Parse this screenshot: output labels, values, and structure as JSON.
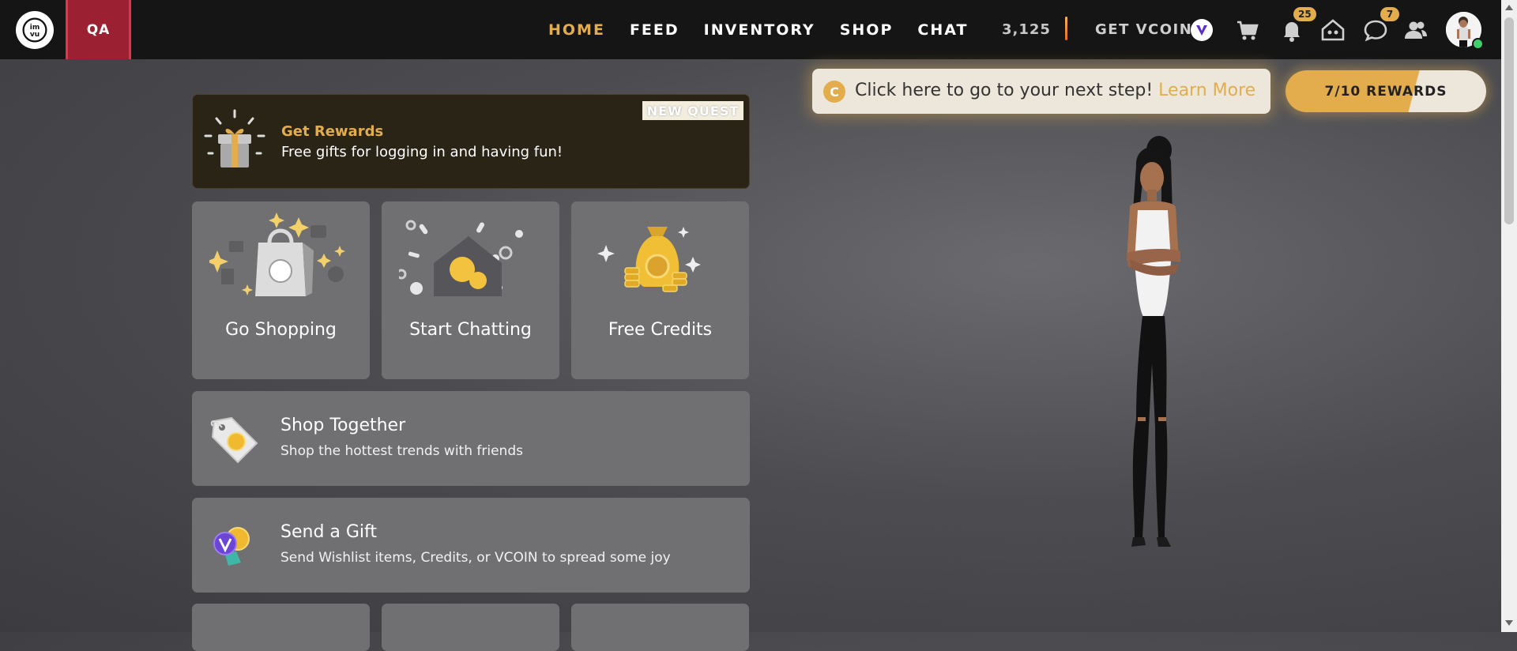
{
  "header": {
    "env_label": "QA",
    "nav": [
      {
        "label": "HOME",
        "active": true
      },
      {
        "label": "FEED",
        "active": false
      },
      {
        "label": "INVENTORY",
        "active": false
      },
      {
        "label": "SHOP",
        "active": false
      },
      {
        "label": "CHAT",
        "active": false
      }
    ],
    "credits": "3,125",
    "get_vcoin": "GET VCOIN",
    "notifications_count": "25",
    "messages_count": "7",
    "icons": [
      "imvu-logo-icon",
      "vcoin-icon",
      "cart-icon",
      "bell-icon",
      "home-icon",
      "chat-bubble-icon",
      "friends-icon"
    ]
  },
  "quest": {
    "title": "Get Rewards",
    "subtitle": "Free gifts for logging in and having fun!",
    "badge": "NEW QUEST"
  },
  "tiles": [
    {
      "label": "Go Shopping"
    },
    {
      "label": "Start Chatting"
    },
    {
      "label": "Free Credits"
    }
  ],
  "rows": [
    {
      "title": "Shop Together",
      "subtitle": "Shop the hottest trends with friends"
    },
    {
      "title": "Send a Gift",
      "subtitle": "Send Wishlist items, Credits, or VCOIN to spread some joy"
    }
  ],
  "tip": {
    "text": "Click here to go to your next step!",
    "link": "Learn More",
    "coin_glyph": "C"
  },
  "rewards": {
    "label": "7/10 REWARDS",
    "progress": 0.7
  },
  "colors": {
    "accent": "#e3ac4c",
    "topbar": "#151515",
    "qa": "#9b2032",
    "tile": "#707073"
  }
}
